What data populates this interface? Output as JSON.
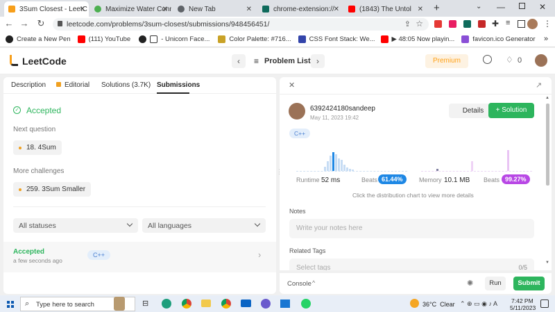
{
  "browser": {
    "tabs": [
      {
        "title": "3Sum Closest - LeetC",
        "color": "#f79f1b"
      },
      {
        "title": "Maximize Water Conn",
        "color": "#4caf50"
      },
      {
        "title": "New Tab",
        "color": "#5f6368"
      },
      {
        "title": "chrome-extension://",
        "color": "#0f6b5c"
      },
      {
        "title": "(1843) The Untol",
        "color": "#ff0000"
      }
    ],
    "url": "leetcode.com/problems/3sum-closest/submissions/948456451/",
    "bookmarks": [
      {
        "label": "Create a New Pen",
        "color": "#222"
      },
      {
        "label": "(111) YouTube",
        "color": "#ff0000"
      },
      {
        "label": "- Unicorn Face...",
        "color": "#333"
      },
      {
        "label": "Color Palette: #716...",
        "color": "#c9a227"
      },
      {
        "label": "CSS Font Stack: We...",
        "color": "#3344aa"
      },
      {
        "label": "▶ 48:05 Now playin...",
        "color": "#ff0000"
      },
      {
        "label": "favicon.ico Generator",
        "color": "#8a4fd6"
      }
    ]
  },
  "lc": {
    "logo": "LeetCode",
    "problem_list": "Problem List",
    "premium": "Premium",
    "streak": "0"
  },
  "left": {
    "tabs": [
      "Description",
      "Editorial",
      "Solutions (3.7K)",
      "Submissions"
    ],
    "status": "Accepted",
    "next_question_label": "Next question",
    "next_question": "18. 4Sum",
    "more_challenges_label": "More challenges",
    "more_challenge": "259. 3Sum Smaller",
    "filter_status": "All statuses",
    "filter_language": "All languages",
    "submission": {
      "status": "Accepted",
      "time": "a few seconds ago",
      "lang": "C++"
    }
  },
  "right": {
    "username": "6392424180sandeep",
    "date": "May 11, 2023 19:42",
    "details_label": "Details",
    "solution_label": "Solution",
    "lang": "C++",
    "runtime_label": "Runtime",
    "runtime": "52 ms",
    "beats_label": "Beats",
    "runtime_beats": "61.44%",
    "memory_label": "Memory",
    "memory": "10.1 MB",
    "memory_beats": "99.27%",
    "hint": "Click the distribution chart to view more details",
    "notes_label": "Notes",
    "notes_placeholder": "Write your notes here",
    "tags_label": "Related Tags",
    "tags_placeholder": "Select tags",
    "tags_count": "0/5"
  },
  "console": {
    "label": "Console",
    "run": "Run",
    "submit": "Submit"
  },
  "taskbar": {
    "search_placeholder": "Type here to search",
    "weather": "36°C  Clear",
    "time": "7:42 PM",
    "date": "5/11/2023"
  },
  "colors": {
    "accent_green": "#2db55d",
    "beats_purple": "#b847e5",
    "beats_blue": "#1e88e5",
    "premium_orange": "#ffa116"
  }
}
